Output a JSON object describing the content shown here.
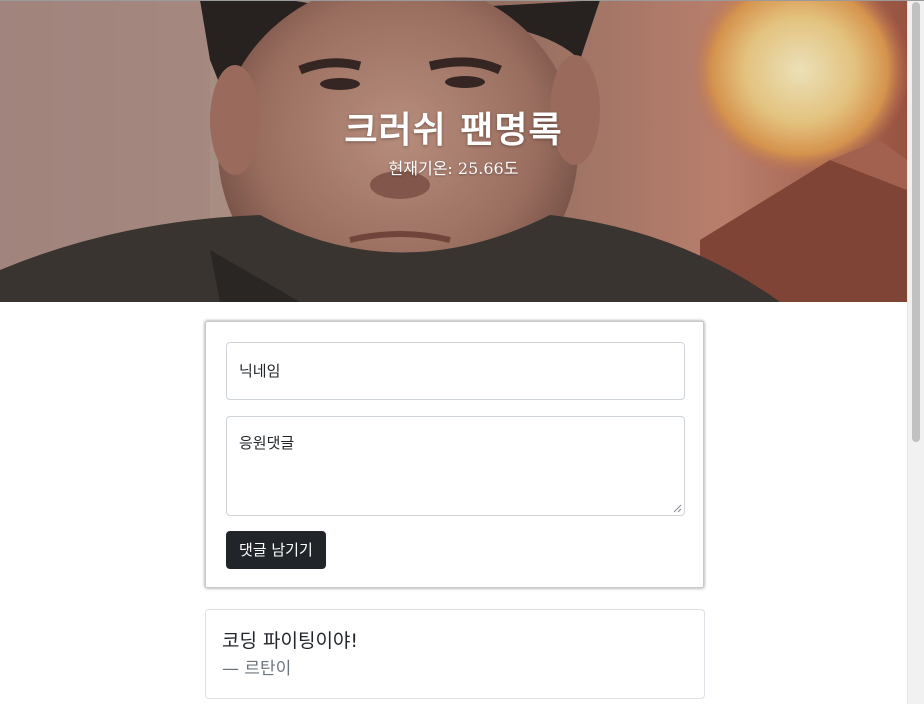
{
  "banner": {
    "title": "크러쉬 팬명록",
    "temperature": "현재기온: 25.66도"
  },
  "form": {
    "nickname_placeholder": "닉네임",
    "comment_placeholder": "응원댓글",
    "submit_label": "댓글 남기기"
  },
  "comments": [
    {
      "text": "코딩 파이팅이야!",
      "author": "— 르탄이"
    }
  ],
  "colors": {
    "button_bg": "#212529",
    "muted_text": "#6c757d",
    "banner_text": "#ffffff"
  }
}
